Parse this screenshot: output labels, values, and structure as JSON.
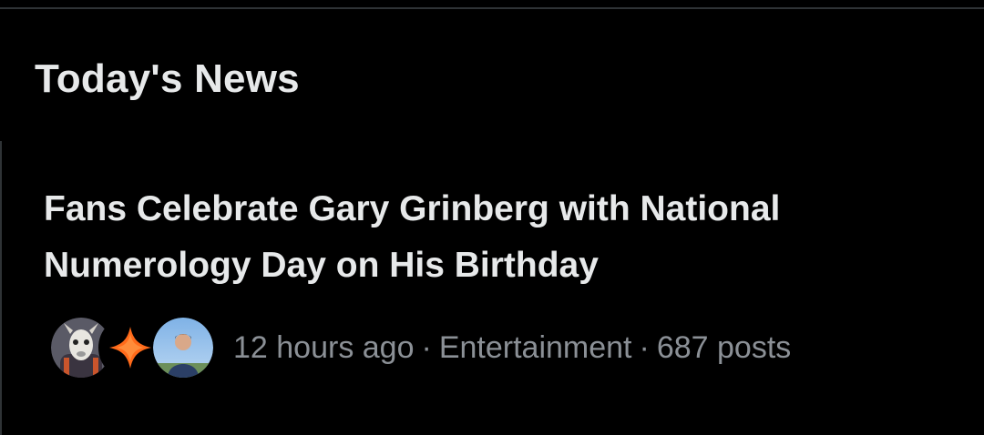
{
  "section": {
    "title": "Today's News"
  },
  "news_item": {
    "headline": "Fans Celebrate Gary Grinberg with National Numerology Day on His Birthday",
    "time_ago": "12 hours ago",
    "separator": "·",
    "category": "Entertainment",
    "post_count": "687 posts",
    "avatars": [
      "goat-avatar",
      "orange-sparkle-avatar",
      "person-avatar"
    ]
  },
  "colors": {
    "background": "#000000",
    "text_primary": "#e7e9ea",
    "text_secondary": "#8b9096",
    "divider": "#2f3336",
    "accent_orange": "#ff6a1a"
  }
}
